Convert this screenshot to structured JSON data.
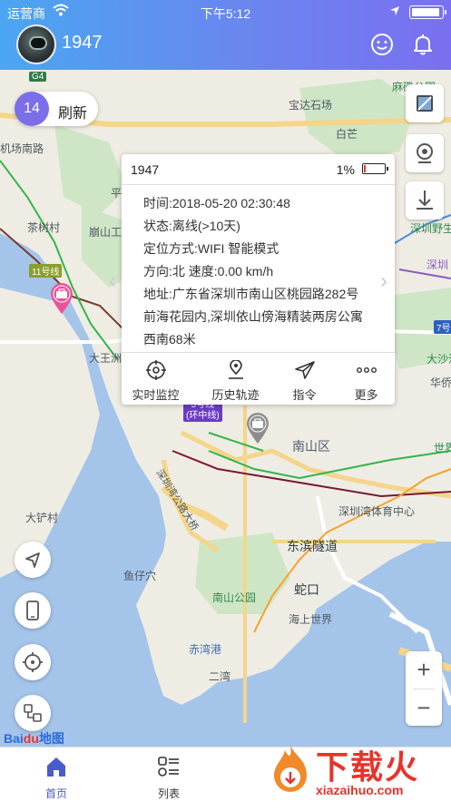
{
  "status_bar": {
    "carrier": "运营商",
    "time": "下午5:12"
  },
  "header": {
    "title": "1947"
  },
  "refresh": {
    "count": "14",
    "label": "刷新"
  },
  "map_labels": {
    "tianbei": "麻磡公园",
    "baoda": "宝达石场",
    "baiyun": "白芒",
    "airport_rd": "机场南路",
    "chaxu": "茶树村",
    "pinshan": "平",
    "nanshan_gong": "崩山工",
    "line11": "11号线",
    "dawang": "大王洲",
    "qianhai": "",
    "dasha": "大沙河",
    "huaqiao": "华侨",
    "line5": "5号线\n(环中线)",
    "nanshan_qu": "南山区",
    "shijie": "世界",
    "sz_bay_sports": "深圳湾体育中心",
    "dachan": "大铲村",
    "binhai": "东滨隧道",
    "yuzi": "鱼仔穴",
    "nanshan_park": "南山公园",
    "shekou": "蛇口",
    "seaworld": "海上世界",
    "chiwan_port": "赤湾港",
    "erwan": "二湾",
    "sz_bay_bridge": "深圳湾公路大桥",
    "szwild": "深圳野生",
    "g4": "G4",
    "shenzhen_e": "深圳",
    "line7": "7号"
  },
  "popup": {
    "device": "1947",
    "battery_pct": "1%",
    "time": "时间:2018-05-20 02:30:48",
    "state": "状态:离线(>10天)",
    "mode": "定位方式:WIFI 智能模式",
    "direction": "方向:北 速度:0.00 km/h",
    "address_line1": "地址:广东省深圳市南山区桃园路282号",
    "address_line2": "前海花园内,深圳依山傍海精装两房公寓",
    "address_line3": "西南68米",
    "actions": [
      {
        "label": "实时监控"
      },
      {
        "label": "历史轨迹"
      },
      {
        "label": "指令"
      },
      {
        "label": "更多"
      }
    ]
  },
  "baidu_logo": {
    "bai": "Bai",
    "du": "du",
    "map": "地图"
  },
  "tabs": [
    {
      "label": "首页"
    },
    {
      "label": "列表"
    }
  ],
  "watermark": {
    "text": "下载火",
    "url": "xiazaihuo.com"
  },
  "colors": {
    "accent": "#7b6ee8",
    "header_start": "#4aa6f2",
    "header_end": "#7a6ff0",
    "pin_pink": "#e8549a",
    "pin_grey": "#8d8d8d"
  }
}
